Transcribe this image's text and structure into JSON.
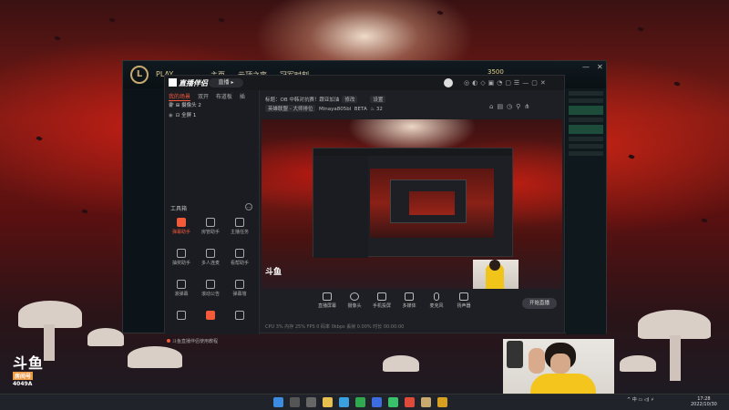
{
  "overlay": {
    "brand": "斗鱼",
    "room_label": "房间号",
    "room_number": "4049A"
  },
  "lol_client": {
    "logo": "L",
    "menu_1": "PLAY",
    "menu_2": "主页",
    "menu_3": "云顶之弈",
    "menu_4": "冠军时刻",
    "coins": "3500",
    "win_min": "—",
    "win_close": "✕"
  },
  "app": {
    "title": "直播伴侣",
    "room_button": "直播 ▸",
    "tabs": [
      "我的场景",
      "双开",
      "布道板",
      "插件"
    ],
    "scenes": [
      "摄像头 2",
      "全屏 1"
    ],
    "tools_title": "工具箱",
    "tools": [
      "弹幕助手",
      "房管助手",
      "主播任务",
      "抽奖助手",
      "多人连麦",
      "看帮助手",
      "滚弹幕",
      "滚动公告",
      "弹幕墙",
      "",
      "",
      ""
    ],
    "bottom_note": "斗鱼直播伴侣使用教程",
    "stream_info": {
      "title_prefix": "标题：OB 中韩对抗赛！跟亚加油",
      "tag_edit": "修改",
      "tag_set": "设置",
      "category": "英雄联盟 - 大师排位",
      "user": "Minaya805bl",
      "rank": "BETA",
      "fans": "32"
    },
    "controls": [
      "直播屏幕",
      "摄像头",
      "手机投屏",
      "多媒体",
      "麦克风",
      "扬声器"
    ],
    "start_button": "开始直播",
    "status_bar": "CPU 3%   内存 25%   FPS 0   码率 0kbps   丢帧 0.00%   时长 00:00:00"
  },
  "taskbar": {
    "time": "17:28",
    "date": "2022/10/30",
    "tray": "^ 中 ▭ ◁) ⚡"
  }
}
